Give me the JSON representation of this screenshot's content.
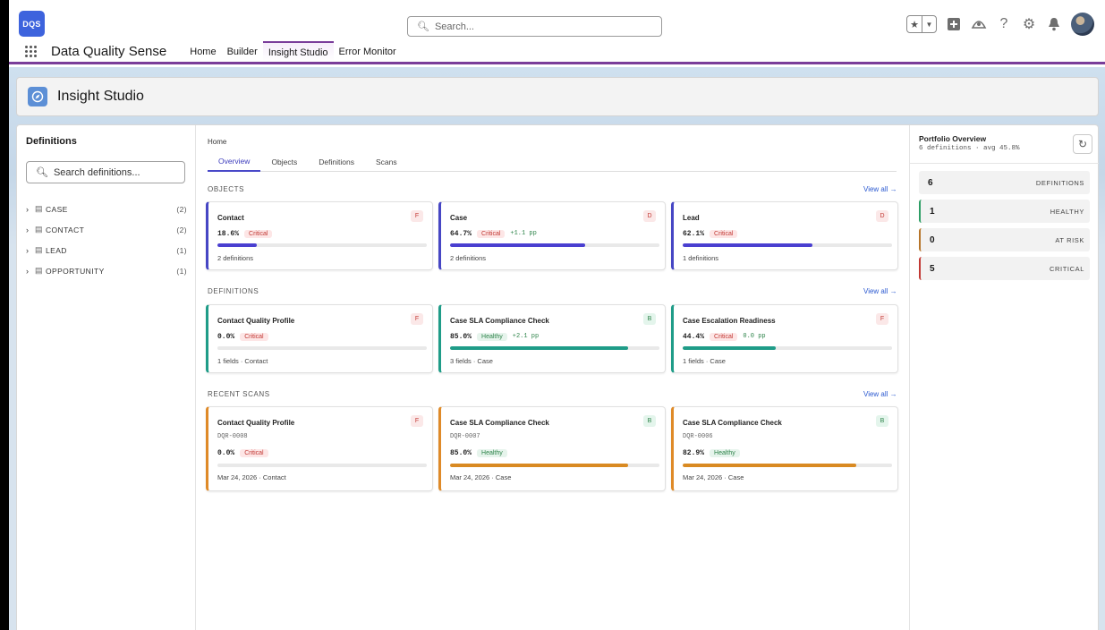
{
  "header": {
    "logo_text": "DQS",
    "search_placeholder": "Search...",
    "icons": [
      "favorites-star-icon",
      "favorites-dropdown-icon",
      "add-icon",
      "trailhead-icon",
      "help-icon",
      "settings-icon",
      "notifications-bell-icon",
      "user-avatar"
    ]
  },
  "nav": {
    "app_name": "Data Quality Sense",
    "items": [
      "Home",
      "Builder",
      "Insight Studio",
      "Error Monitor"
    ],
    "active": "Insight Studio"
  },
  "page_header": {
    "title": "Insight Studio"
  },
  "sidebar": {
    "title": "Definitions",
    "search_placeholder": "Search definitions...",
    "objects": [
      {
        "name": "CASE",
        "count": "(2)"
      },
      {
        "name": "CONTACT",
        "count": "(2)"
      },
      {
        "name": "LEAD",
        "count": "(1)"
      },
      {
        "name": "OPPORTUNITY",
        "count": "(1)"
      }
    ]
  },
  "main": {
    "breadcrumb": "Home",
    "tabs": [
      "Overview",
      "Objects",
      "Definitions",
      "Scans"
    ],
    "active_tab": "Overview",
    "view_all": "View all →",
    "sections": {
      "objects": {
        "label": "OBJECTS",
        "cards": [
          {
            "title": "Contact",
            "grade": "F",
            "pct": "18.6%",
            "status": "Critical",
            "delta": "",
            "progress": 0.186,
            "footer": "2 definitions"
          },
          {
            "title": "Case",
            "grade": "D",
            "pct": "64.7%",
            "status": "Critical",
            "delta": "+1.1 pp",
            "progress": 0.647,
            "footer": "2 definitions"
          },
          {
            "title": "Lead",
            "grade": "D",
            "pct": "62.1%",
            "status": "Critical",
            "delta": "",
            "progress": 0.621,
            "footer": "1 definitions"
          }
        ]
      },
      "definitions": {
        "label": "DEFINITIONS",
        "cards": [
          {
            "title": "Contact Quality Profile",
            "grade": "F",
            "pct": "0.0%",
            "status": "Critical",
            "delta": "",
            "progress": 0.0,
            "footer": "1 fields · Contact"
          },
          {
            "title": "Case SLA Compliance Check",
            "grade": "B",
            "pct": "85.0%",
            "status": "Healthy",
            "delta": "+2.1 pp",
            "progress": 0.85,
            "footer": "3 fields · Case"
          },
          {
            "title": "Case Escalation Readiness",
            "grade": "F",
            "pct": "44.4%",
            "status": "Critical",
            "delta": "0.0 pp",
            "progress": 0.444,
            "footer": "1 fields · Case"
          }
        ]
      },
      "recent_scans": {
        "label": "RECENT SCANS",
        "cards": [
          {
            "title": "Contact Quality Profile",
            "grade": "F",
            "id": "DQR-0008",
            "pct": "0.0%",
            "status": "Critical",
            "progress": 0.0,
            "footer": "Mar 24, 2026 · Contact"
          },
          {
            "title": "Case SLA Compliance Check",
            "grade": "B",
            "id": "DQR-0007",
            "pct": "85.0%",
            "status": "Healthy",
            "progress": 0.85,
            "footer": "Mar 24, 2026 · Case"
          },
          {
            "title": "Case SLA Compliance Check",
            "grade": "B",
            "id": "DQR-0006",
            "pct": "82.9%",
            "status": "Healthy",
            "progress": 0.829,
            "footer": "Mar 24, 2026 · Case"
          }
        ]
      }
    }
  },
  "portfolio": {
    "title": "Portfolio Overview",
    "subtitle": "6 definitions · avg 45.8%",
    "stats": [
      {
        "value": "6",
        "label": "DEFINITIONS"
      },
      {
        "value": "1",
        "label": "HEALTHY"
      },
      {
        "value": "0",
        "label": "AT RISK"
      },
      {
        "value": "5",
        "label": "CRITICAL"
      }
    ]
  },
  "colors": {
    "brand_purple": "#7a3d9a",
    "object_accent": "#4646c4",
    "definition_accent": "#1f9c88",
    "scan_accent": "#df8a28",
    "critical": "#c23934",
    "healthy": "#2e844a"
  }
}
